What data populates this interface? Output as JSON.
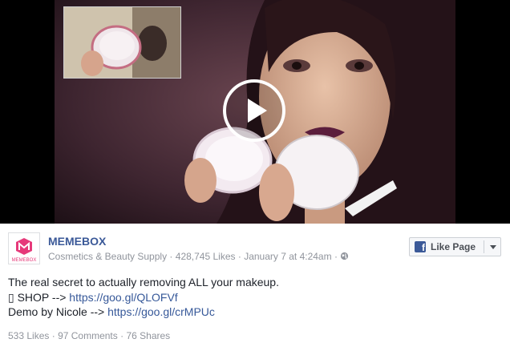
{
  "video": {
    "thumbnail_icon": "play-icon"
  },
  "page": {
    "name": "MEMEBOX",
    "avatar_text": "MEMEBOX",
    "category": "Cosmetics & Beauty Supply",
    "likes": "428,745 Likes",
    "date": "January 7 at 4:24am",
    "separator": "·",
    "audience_icon": "globe-icon",
    "brand_color": "#e6397a"
  },
  "like_page_button": {
    "label": "Like Page",
    "icon": "facebook-icon",
    "dropdown_icon": "chevron-down-icon"
  },
  "post": {
    "line1": "The real secret to actually removing ALL your makeup.",
    "line2_prefix": "▯ SHOP -->",
    "line2_link": "https://goo.gl/QLOFVf",
    "line3_prefix": "Demo by Nicole -->",
    "line3_link": "https://goo.gl/crMPUc"
  },
  "stats": {
    "likes": "533 Likes",
    "comments": "97 Comments",
    "shares": "76 Shares",
    "separator": "·"
  },
  "colors": {
    "link": "#365899",
    "page_name": "#3b5998",
    "meta": "#90949c",
    "text": "#1d2129"
  }
}
